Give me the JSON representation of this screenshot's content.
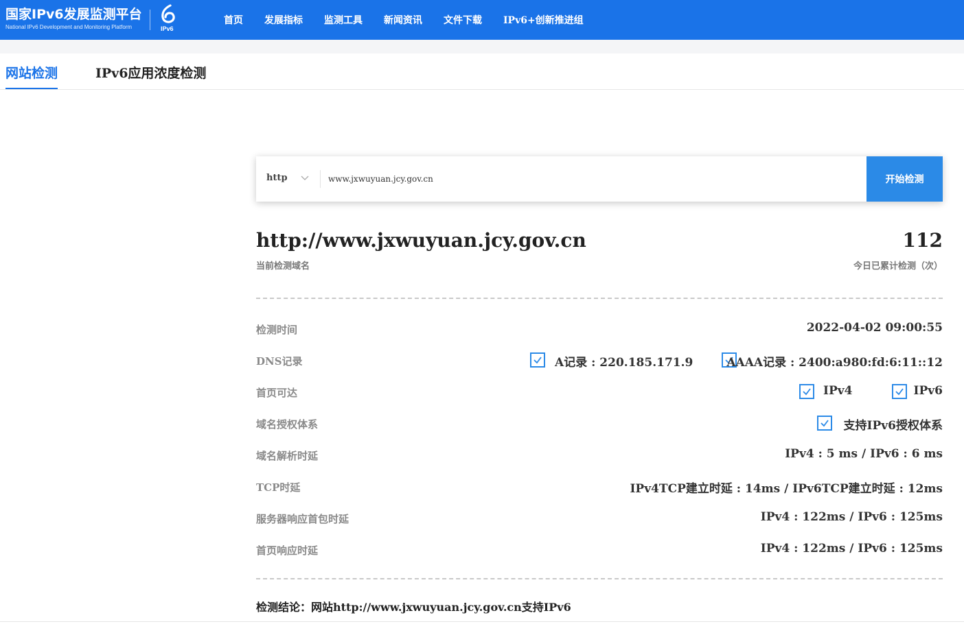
{
  "header": {
    "logo_title": "国家IPv6发展监测平台",
    "logo_subtitle": "National IPv6 Development and Monitoring Platform",
    "logo_mark_text": "IPv6",
    "nav": [
      "首页",
      "发展指标",
      "监测工具",
      "新闻资讯",
      "文件下载",
      "IPv6+创新推进组"
    ],
    "accent_color": "#1a73e8"
  },
  "tabs": [
    "网站检测",
    "IPv6应用浓度检测"
  ],
  "search": {
    "protocol": "http",
    "url_value": "www.jxwuyuan.jcy.gov.cn",
    "button_label": "开始检测"
  },
  "summary": {
    "domain": "http://www.jxwuyuan.jcy.gov.cn",
    "domain_caption": "当前检测域名",
    "count": "112",
    "count_caption": "今日已累计检测（次）"
  },
  "rows": {
    "time": {
      "label": "检测时间",
      "value": "2022-04-02 09:00:55"
    },
    "dns": {
      "label": "DNS记录",
      "a_record": "A记录 : 220.185.171.9",
      "aaaa_record": "AAAA记录 : 2400:a980:fd:6:11::12"
    },
    "reach": {
      "label": "首页可达",
      "ipv4": "IPv4",
      "ipv6": "IPv6"
    },
    "auth": {
      "label": "域名授权体系",
      "value": "支持IPv6授权体系"
    },
    "resolve": {
      "label": "域名解析时延",
      "value": "IPv4 : 5 ms / IPv6 : 6 ms"
    },
    "tcp": {
      "label": "TCP时延",
      "value": "IPv4TCP建立时延 : 14ms / IPv6TCP建立时延 : 12ms"
    },
    "server": {
      "label": "服务器响应首包时延",
      "value": "IPv4 : 122ms / IPv6 : 125ms"
    },
    "homepage": {
      "label": "首页响应时延",
      "value": "IPv4 : 122ms / IPv6 : 125ms"
    }
  },
  "conclusion": "检测结论：网站http://www.jxwuyuan.jcy.gov.cn支持IPv6"
}
